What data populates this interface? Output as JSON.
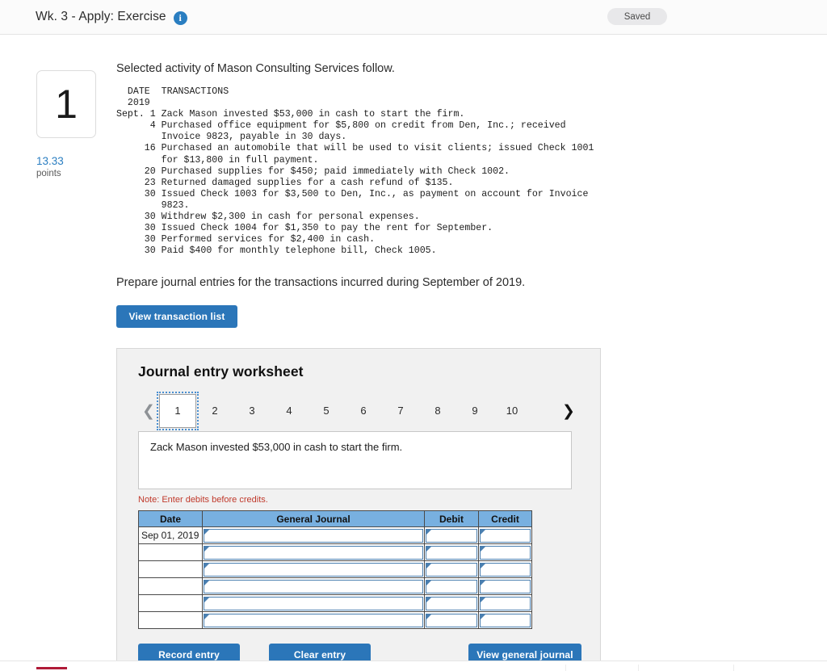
{
  "header": {
    "title": "Wk. 3 - Apply: Exercise",
    "info_icon": "info-icon",
    "saved_label": "Saved"
  },
  "question": {
    "number": "1",
    "points_value": "13.33",
    "points_label": "points"
  },
  "content": {
    "lede": "Selected activity of Mason Consulting Services follow.",
    "transactions_text": "  DATE  TRANSACTIONS\n  2019\nSept. 1 Zack Mason invested $53,000 in cash to start the firm.\n      4 Purchased office equipment for $5,800 on credit from Den, Inc.; received\n        Invoice 9823, payable in 30 days.\n     16 Purchased an automobile that will be used to visit clients; issued Check 1001\n        for $13,800 in full payment.\n     20 Purchased supplies for $450; paid immediately with Check 1002.\n     23 Returned damaged supplies for a cash refund of $135.\n     30 Issued Check 1003 for $3,500 to Den, Inc., as payment on account for Invoice\n        9823.\n     30 Withdrew $2,300 in cash for personal expenses.\n     30 Issued Check 1004 for $1,350 to pay the rent for September.\n     30 Performed services for $2,400 in cash.\n     30 Paid $400 for monthly telephone bill, Check 1005.",
    "prompt": "Prepare journal entries for the transactions incurred during September of 2019.",
    "view_transaction_list_label": "View transaction list"
  },
  "worksheet": {
    "title": "Journal entry worksheet",
    "pager": {
      "prev_icon": "chevron-left-icon",
      "next_icon": "chevron-right-icon",
      "pages": [
        "1",
        "2",
        "3",
        "4",
        "5",
        "6",
        "7",
        "8",
        "9",
        "10"
      ],
      "active_page": "1"
    },
    "description": "Zack Mason invested $53,000 in cash to start the firm.",
    "note": "Note: Enter debits before credits.",
    "table": {
      "columns": [
        "Date",
        "General Journal",
        "Debit",
        "Credit"
      ],
      "rows": [
        {
          "date": "Sep 01, 2019",
          "general_journal": "",
          "debit": "",
          "credit": ""
        },
        {
          "date": "",
          "general_journal": "",
          "debit": "",
          "credit": ""
        },
        {
          "date": "",
          "general_journal": "",
          "debit": "",
          "credit": ""
        },
        {
          "date": "",
          "general_journal": "",
          "debit": "",
          "credit": ""
        },
        {
          "date": "",
          "general_journal": "",
          "debit": "",
          "credit": ""
        },
        {
          "date": "",
          "general_journal": "",
          "debit": "",
          "credit": ""
        }
      ]
    },
    "actions": {
      "record_label": "Record entry",
      "clear_label": "Clear entry",
      "journal_label": "View general journal"
    }
  },
  "colors": {
    "accent_blue": "#2b76b9",
    "link_blue": "#2a7ec1",
    "table_header_blue": "#78b0e0",
    "note_red": "#c0392b",
    "footer_accent": "#b01b38"
  }
}
